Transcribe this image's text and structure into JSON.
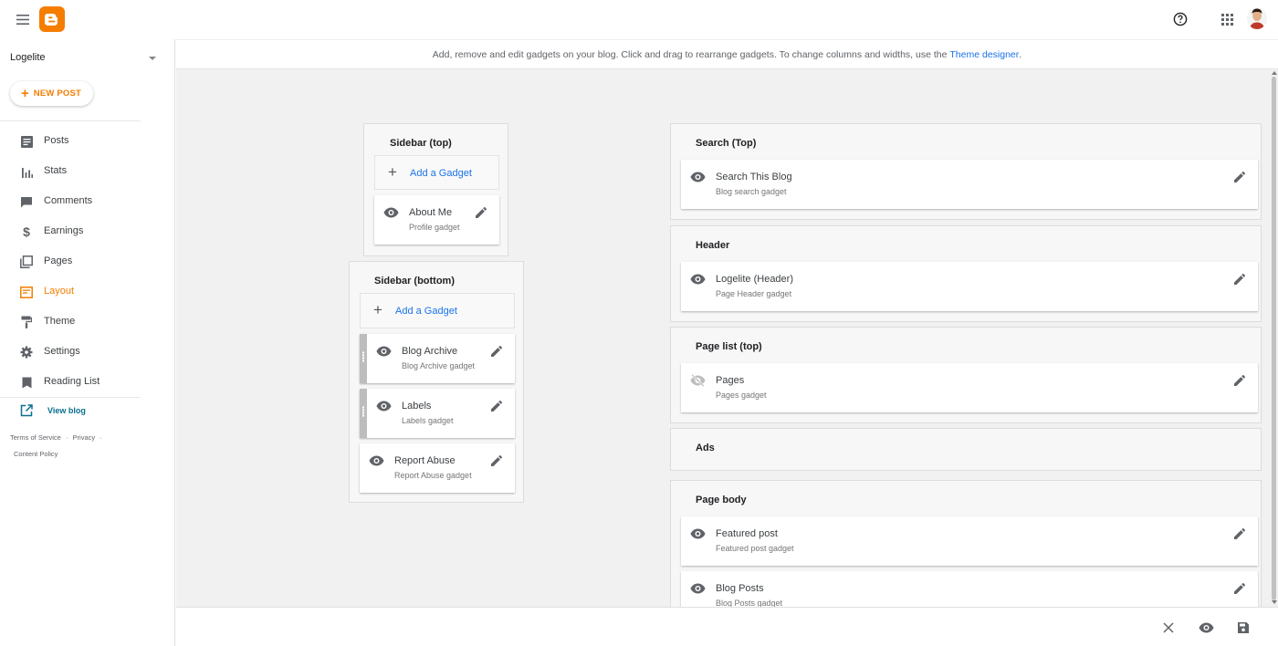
{
  "blog": {
    "name": "Logelite"
  },
  "new_post_label": "NEW POST",
  "nav": {
    "items": [
      {
        "label": "Posts",
        "icon": "posts-icon"
      },
      {
        "label": "Stats",
        "icon": "stats-icon"
      },
      {
        "label": "Comments",
        "icon": "comments-icon"
      },
      {
        "label": "Earnings",
        "icon": "dollar-icon"
      },
      {
        "label": "Pages",
        "icon": "pages-icon"
      },
      {
        "label": "Layout",
        "icon": "layout-icon",
        "active": true
      },
      {
        "label": "Theme",
        "icon": "paint-roller-icon"
      },
      {
        "label": "Settings",
        "icon": "gear-icon"
      },
      {
        "label": "Reading List",
        "icon": "bookmark-icon"
      }
    ],
    "view_blog": "View blog"
  },
  "footer": {
    "terms": "Terms of Service",
    "privacy": "Privacy",
    "content_policy": "Content Policy",
    "separator": "·"
  },
  "info": {
    "text": "Add, remove and edit gadgets on your blog. Click and drag to rearrange gadgets. To change columns and widths, use the ",
    "link": "Theme designer",
    "end": "."
  },
  "layout": {
    "sidebar_top": {
      "title": "Sidebar (top)",
      "add_label": "Add a Gadget",
      "gadgets": [
        {
          "name": "About Me",
          "sub": "Profile gadget"
        }
      ]
    },
    "sidebar_bottom": {
      "title": "Sidebar (bottom)",
      "add_label": "Add a Gadget",
      "gadgets": [
        {
          "name": "Blog Archive",
          "sub": "Blog Archive gadget"
        },
        {
          "name": "Labels",
          "sub": "Labels gadget"
        },
        {
          "name": "Report Abuse",
          "sub": "Report Abuse gadget"
        }
      ]
    },
    "search_top": {
      "title": "Search (Top)",
      "gadget": {
        "name": "Search This Blog",
        "sub": "Blog search gadget"
      }
    },
    "header": {
      "title": "Header",
      "gadget": {
        "name": "Logelite (Header)",
        "sub": "Page Header gadget"
      }
    },
    "page_list": {
      "title": "Page list (top)",
      "gadget": {
        "name": "Pages",
        "sub": "Pages gadget",
        "hidden": true
      }
    },
    "ads": {
      "title": "Ads"
    },
    "page_body": {
      "title": "Page body",
      "gadgets": [
        {
          "name": "Featured post",
          "sub": "Featured post gadget"
        },
        {
          "name": "Blog Posts",
          "sub": "Blog Posts gadget"
        }
      ]
    }
  },
  "colors": {
    "accent": "#f57d00",
    "link": "#1a73e8",
    "canvas": "#f1f1f1"
  }
}
